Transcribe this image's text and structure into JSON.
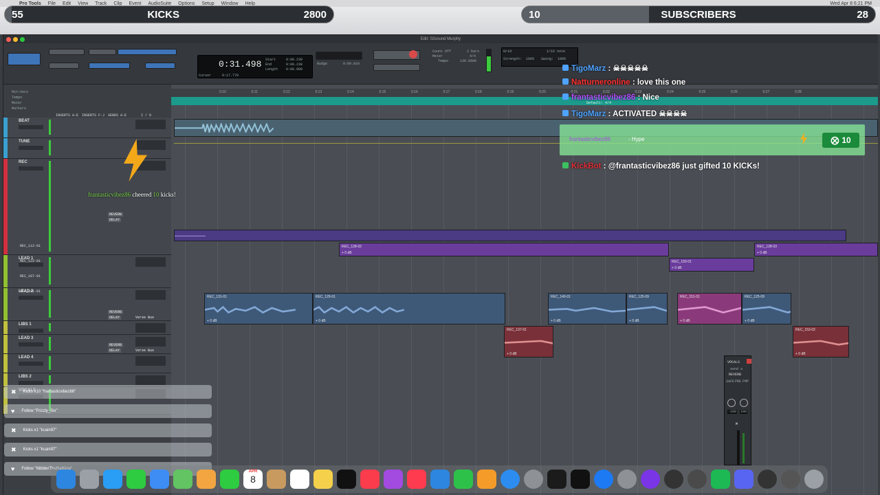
{
  "menubar": {
    "items": [
      "Pro Tools",
      "File",
      "Edit",
      "View",
      "Track",
      "Clip",
      "Event",
      "AudioSuite",
      "Options",
      "Setup",
      "Window",
      "Help"
    ],
    "clock": "Wed Apr 8  6:21 PM"
  },
  "goals": {
    "kicks": {
      "current": "55",
      "label": "KICKS",
      "target": "2800",
      "progress": 0.02
    },
    "subs": {
      "current": "10",
      "label": "SUBSCRIBERS",
      "target": "28",
      "progress": 0.36
    }
  },
  "window": {
    "title": "Edit: 02sound Murphy"
  },
  "toolbar": {
    "counter_main": "0:31.498",
    "start_label": "Start",
    "end_label": "End",
    "length_label": "Length",
    "start": "0:09.230",
    "end": "0:09.230",
    "length": "0:00.000",
    "cursor_label": "Cursor",
    "cursor": "0:17.770",
    "nudge_label": "Nudge",
    "nudge": "0:00.010",
    "grid_label": "Grid",
    "grid": "1/16 note",
    "strength_label": "Strength:",
    "strength": "100%",
    "swing_label": "Swing:",
    "swing": "100%",
    "tempo_label": "Tempo",
    "tempo": "130.0000",
    "count_off": "Count Off",
    "meter": "Meter",
    "bars": "2 bars",
    "sig": "4/4"
  },
  "ruler": {
    "min_secs": "Min:Secs",
    "ticks": [
      "0:10",
      "0:11",
      "0:12",
      "0:13",
      "0:14",
      "0:15",
      "0:16",
      "0:17",
      "0:18",
      "0:19",
      "0:20",
      "0:21",
      "0:22",
      "0:23",
      "0:24",
      "0:25",
      "0:26",
      "0:27",
      "0:28"
    ],
    "rows": [
      "Tempo",
      "Meter",
      "Markers"
    ],
    "default": "Default: 4/4"
  },
  "columns": [
    "INSERTS A-E",
    "INSERTS F-J",
    "SENDS A-E",
    "I / O"
  ],
  "tracks": [
    {
      "name": "BEAT",
      "color": "#3aa0d0"
    },
    {
      "name": "TUNE",
      "color": "#3aa0d0"
    },
    {
      "name": "REC",
      "color": "#d03040"
    },
    {
      "name": "LEAD 1",
      "color": "#90c030"
    },
    {
      "name": "LEAD 2",
      "color": "#90c030"
    },
    {
      "name": "LIBS 1",
      "color": "#c0c040"
    },
    {
      "name": "LEAD 3",
      "color": "#c0c040"
    },
    {
      "name": "LEAD 4",
      "color": "#c0c040"
    },
    {
      "name": "LIBS 2",
      "color": "#c0c040"
    },
    {
      "name": "VOCALS",
      "color": "#c0c040"
    }
  ],
  "subtracks": [
    "REC_112-01",
    "REC_122-01",
    "REC_187-01",
    "REC_181-01"
  ],
  "inserts": {
    "reverb": "REVERB",
    "delay": "DELAY",
    "verse_bus": "Verse Bus",
    "vol": "vol",
    "pan": "pan"
  },
  "clips": [
    {
      "name": "REC_128-02",
      "db": "+ 0 dB"
    },
    {
      "name": "REC_128-03",
      "db": "+ 0 dB"
    },
    {
      "name": "REC_193-01",
      "db": "+ 0 dB"
    },
    {
      "name": "REC_131-01",
      "db": "+ 0 dB"
    },
    {
      "name": "REC_129-01",
      "db": "+ 0 dB"
    },
    {
      "name": "REC_140-01",
      "db": "+ 0 dB"
    },
    {
      "name": "REC_125-09",
      "db": "+ 0 dB"
    },
    {
      "name": "REC_151-01",
      "db": "+ 0 dB"
    },
    {
      "name": "REC_125-09",
      "db": "+ 0 dB"
    },
    {
      "name": "REC_137-01",
      "db": "+ 0 dB"
    },
    {
      "name": "REC_153-02",
      "db": "+ 0 dB"
    }
  ],
  "chat": [
    {
      "user": "TigoMarz",
      "sep": " : ",
      "text": "☠☠☠☠☠",
      "color": "#4fa3ff"
    },
    {
      "user": "Natturneronline",
      "sep": " : ",
      "text": "love this one",
      "color": "#ff3030"
    },
    {
      "user": "frantasticvibez86",
      "sep": " : ",
      "text": "Nice",
      "color": "#b84fff"
    },
    {
      "user": "TigoMarz",
      "sep": " : ",
      "text": "ACTIVATED ☠☠☠☠",
      "color": "#4fa3ff"
    },
    {
      "user": "KickBot",
      "sep": " : ",
      "text": "@frantasticvibez86 just gifted 10 KICKs!",
      "color": "#e0303a"
    }
  ],
  "hype": {
    "user": "frantasticvibez86",
    "label": " - Hype",
    "count": "10"
  },
  "cheer": {
    "user": "frantasticvibez86",
    "text": " cheered ",
    "amount": "10",
    "suffix": " kicks!"
  },
  "alerts": [
    {
      "icon": "kick",
      "text": "Kicks x10 \"frantasticvibez86\""
    },
    {
      "icon": "heart",
      "text": "Follow \"Frizzly_Six\""
    },
    {
      "icon": "kick",
      "text": "Kicks x1 \"kcain97\""
    },
    {
      "icon": "kick",
      "text": "Kicks x1 \"kcain97\""
    },
    {
      "icon": "heart",
      "text": "Follow \"NibblerTheRatKing\""
    }
  ],
  "mixer": {
    "name": "VOCALS",
    "send": "send a",
    "plugin": "REVERB",
    "safe": "SAFE",
    "pre": "PRE",
    "fmp": "FMP",
    "vol": "-180",
    "pan": "100",
    "m": "M"
  },
  "dock": {
    "calendar_month": "APR",
    "calendar_day": "8",
    "icons": [
      "finder",
      "launchpad",
      "safari",
      "messages",
      "mail",
      "maps",
      "photos",
      "facetime",
      "calendar",
      "contacts",
      "reminders",
      "notes",
      "appletv",
      "music",
      "podcasts",
      "news",
      "keynote",
      "numbers",
      "pages",
      "appstore",
      "settings",
      "pro-tools",
      "ilok",
      "app",
      "app",
      "app",
      "app",
      "app",
      "spotify",
      "discord",
      "obs",
      "app",
      "trash"
    ],
    "colors": [
      "#2d86e0",
      "#9aa0a6",
      "#2a9df4",
      "#2ecc40",
      "#3d8df5",
      "#62c462",
      "#f2a541",
      "#2ecc40",
      "#ffffff",
      "#c89a60",
      "#ffffff",
      "#f5d04a",
      "#111111",
      "#fa3c4c",
      "#a34ae0",
      "#ff3b4f",
      "#2d86e0",
      "#2ec14a",
      "#f59b2a",
      "#2d8cf0",
      "#8e9297",
      "#1b1b1b",
      "#111111",
      "#1d7af3",
      "#8e9297",
      "#7a35e6",
      "#333333",
      "#4a4a4a",
      "#1db954",
      "#5865f2",
      "#333333",
      "#555555",
      "#9aa0a6"
    ]
  }
}
